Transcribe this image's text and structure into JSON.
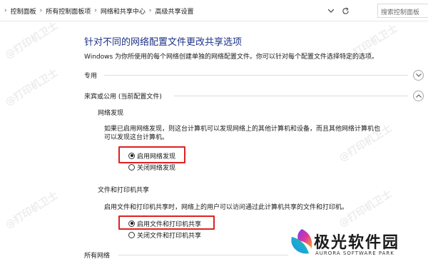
{
  "breadcrumbs": [
    "控制面板",
    "所有控制面板项",
    "网络和共享中心",
    "高级共享设置"
  ],
  "search": {
    "placeholder": "搜索控制面板"
  },
  "title": "针对不同的网络配置文件更改共享选项",
  "description": "Windows 为你所使用的每个网络创建单独的网络配置文件。你可以针对每个配置文件选择特定的选项。",
  "sections": {
    "private": {
      "label": "专用",
      "expanded": false
    },
    "guest": {
      "label": "来宾或公用 (当前配置文件)",
      "expanded": true
    },
    "all": {
      "label": "所有网络"
    }
  },
  "network_discovery": {
    "heading": "网络发现",
    "description_line1": "如果已启用网络发现，则这台计算机可以发现网络上的其他计算机和设备，而且其他网络计算机也",
    "description_line2": "可以发现这台计算机。",
    "options": [
      {
        "label": "启用网络发现",
        "selected": true
      },
      {
        "label": "关闭网络发现",
        "selected": false
      }
    ]
  },
  "file_sharing": {
    "heading": "文件和打印机共享",
    "description": "启用文件和打印机共享时，网络上的用户可以访问通过此计算机共享的文件和打印机。",
    "options": [
      {
        "label": "启用文件和打印机共享",
        "selected": true
      },
      {
        "label": "关闭文件和打印机共享",
        "selected": false
      }
    ]
  },
  "watermark": "@打印机卫士",
  "brand": {
    "name": "极光软件园",
    "sub": "AURORA SOFTWARE PARK"
  },
  "colors": {
    "title": "#1e3287",
    "highlight": "#e02020",
    "accent": "#1a73e8"
  }
}
